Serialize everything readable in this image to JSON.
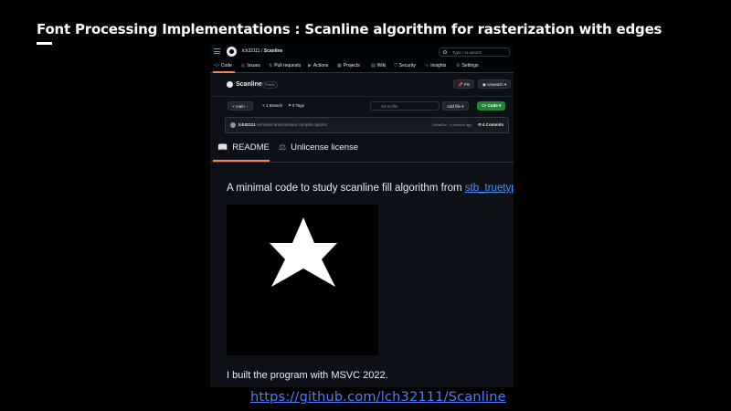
{
  "slide": {
    "title": "Font Processing Implementations : Scanline algorithm for rasterization with edges",
    "url": "https://github.com/lch32111/Scanline"
  },
  "github": {
    "owner": "lch32111",
    "separator": "/",
    "repo": "Scanline",
    "search_placeholder": "Type / to search",
    "nav": [
      {
        "icon": "code-icon",
        "label": "Code"
      },
      {
        "icon": "issues-icon",
        "label": "Issues"
      },
      {
        "icon": "pull-requests-icon",
        "label": "Pull requests"
      },
      {
        "icon": "actions-icon",
        "label": "Actions"
      },
      {
        "icon": "projects-icon",
        "label": "Projects"
      },
      {
        "icon": "wiki-icon",
        "label": "Wiki"
      },
      {
        "icon": "security-icon",
        "label": "Security"
      },
      {
        "icon": "insights-icon",
        "label": "Insights"
      },
      {
        "icon": "settings-icon",
        "label": "Settings"
      }
    ],
    "visibility": "Public",
    "pin_label": "Pin",
    "unwatch_label": "Unwatch",
    "branch": "main",
    "branches": "1 Branch",
    "tags": "0 Tags",
    "goto_placeholder": "Go to file",
    "add_file_label": "Add file",
    "code_label": "Code",
    "commit": {
      "user": "lch32111",
      "message": "removed unnecessary compile options",
      "hash_time": "24ba61a · 4 months ago",
      "count": "4 Commits"
    }
  },
  "readme": {
    "tab_readme": "README",
    "tab_license": "Unlicense license",
    "intro_text": "A minimal code to study scanline fill algorithm from ",
    "intro_link": "stb_truetype.h",
    "intro_end": ".",
    "footnote": "I built the program with MSVC 2022."
  },
  "colors": {
    "accent_link": "#4493f8",
    "tab_underline": "#f78166",
    "code_button": "#238636"
  }
}
